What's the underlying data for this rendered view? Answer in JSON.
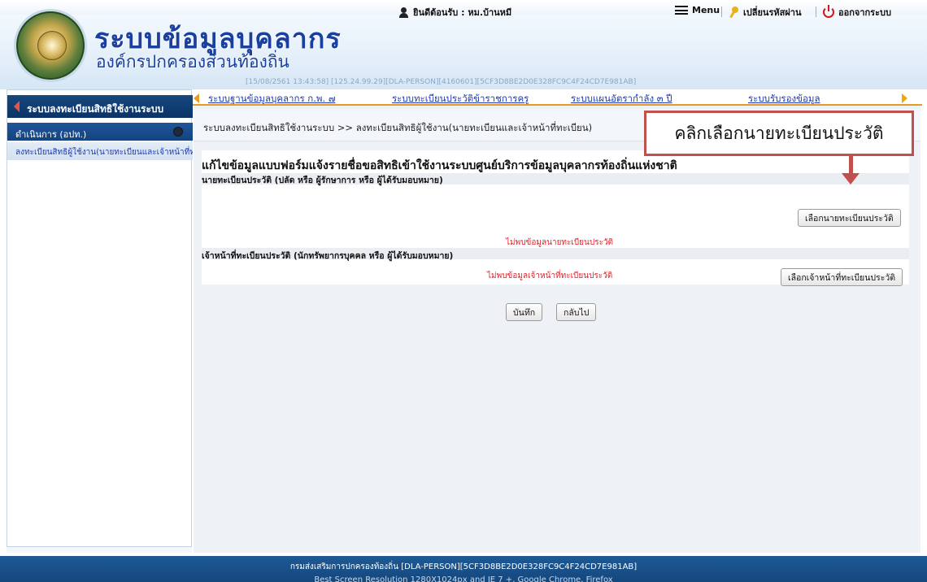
{
  "header": {
    "title": "ระบบข้อมูลบุคลากร",
    "subtitle": "องค์กรปกครองส่วนท้องถิ่น",
    "session": "[15/08/2561 13:43:58] [125.24.99.29][DLA-PERSON][4160601][5CF3D8BE2D0E328FC9C4F24CD7E981AB]"
  },
  "topbar": {
    "welcome": "ยินดีต้อนรับ : หม.บ้านหมี",
    "menu": "Menu",
    "change_password": "เปลี่ยนรหัสผ่าน",
    "logout": "ออกจากระบบ"
  },
  "nav": {
    "links": [
      "ระบบฐานข้อมูลบุคลากร ก.พ. ๗",
      "ระบบทะเบียนประวัติข้าราชการครู",
      "ระบบแผนอัตรากำลัง ๓ ปี",
      "ระบบรับรองข้อมูล"
    ]
  },
  "sidebar": {
    "title": "ระบบลงทะเบียนสิทธิใช้งานระบบ",
    "section": "ดำเนินการ (อปท.)",
    "item": "ลงทะเบียนสิทธิผู้ใช้งาน(นายทะเบียนและเจ้าหน้าที่ทะเบียน)"
  },
  "main": {
    "breadcrumb": "ระบบลงทะเบียนสิทธิใช้งานระบบ >> ลงทะเบียนสิทธิผู้ใช้งาน(นายทะเบียนและเจ้าหน้าที่ทะเบียน)",
    "form_title": "แก้ไขข้อมูลแบบฟอร์มแจ้งรายชื่อขอสิทธิเข้าใช้งานระบบศูนย์บริการข้อมูลบุคลากรท้องถิ่นแห่งชาติ",
    "registrar": {
      "label": "นายทะเบียนประวัติ (ปลัด หรือ ผู้รักษาการ หรือ ผู้ได้รับมอบหมาย)",
      "button": "เลือกนายทะเบียนประวัติ",
      "empty": "ไม่พบข้อมูลนายทะเบียนประวัติ"
    },
    "officer": {
      "label": "เจ้าหน้าที่ทะเบียนประวัติ (นักทรัพยากรบุคคล หรือ ผู้ได้รับมอบหมาย)",
      "button": "เลือกเจ้าหน้าที่ทะเบียนประวัติ",
      "empty": "ไม่พบข้อมูลเจ้าหน้าที่ทะเบียนประวัติ"
    },
    "save": "บันทึก",
    "back": "กลับไป"
  },
  "callout": {
    "text": "คลิกเลือกนายทะเบียนประวัติ"
  },
  "footer": {
    "line1": "กรมส่งเสริมการปกครองท้องถิ่น [DLA-PERSON][5CF3D8BE2D0E328FC9C4F24CD7E981AB]",
    "line2": "Best Screen Resolution 1280X1024px and IE 7 +, Google Chrome, Firefox"
  }
}
